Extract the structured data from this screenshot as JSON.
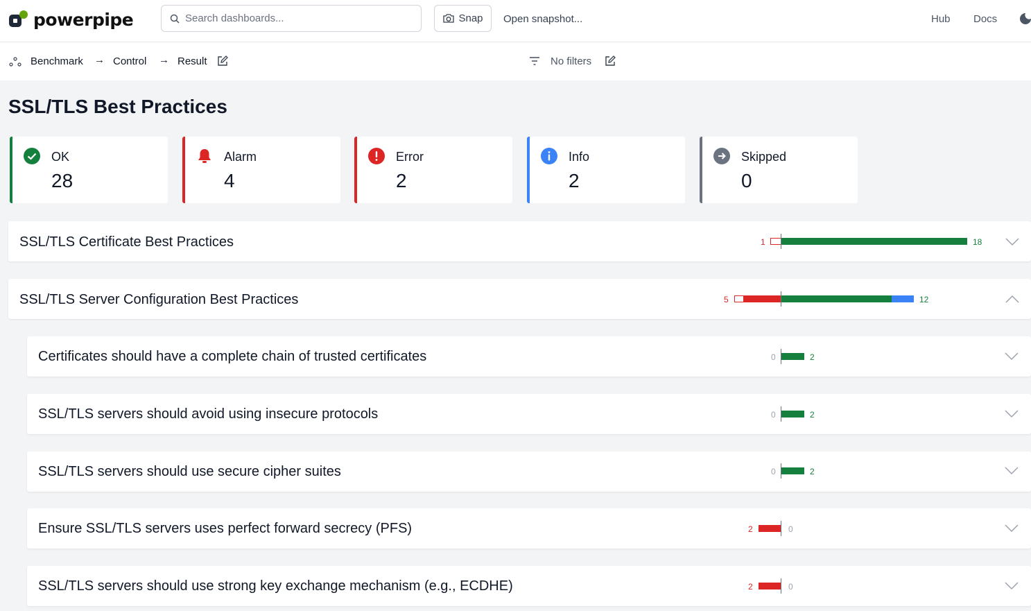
{
  "app": {
    "brand": "powerpipe",
    "search_placeholder": "Search dashboards...",
    "snap_label": "Snap",
    "open_snapshot_label": "Open snapshot...",
    "nav_hub": "Hub",
    "nav_docs": "Docs"
  },
  "breadcrumb": {
    "items": [
      "Benchmark",
      "Control",
      "Result"
    ],
    "arrow": "→",
    "filters_label": "No filters"
  },
  "page": {
    "title": "SSL/TLS Best Practices"
  },
  "summary": [
    {
      "label": "OK",
      "value": "28",
      "color": "#15803d",
      "icon": "check-circle-icon"
    },
    {
      "label": "Alarm",
      "value": "4",
      "color": "#dc2626",
      "icon": "bell-icon"
    },
    {
      "label": "Error",
      "value": "2",
      "color": "#dc2626",
      "icon": "exclamation-circle-icon"
    },
    {
      "label": "Info",
      "value": "2",
      "color": "#3b82f6",
      "icon": "info-circle-icon"
    },
    {
      "label": "Skipped",
      "value": "0",
      "color": "#6b7280",
      "icon": "arrow-right-circle-icon"
    }
  ],
  "groups": [
    {
      "title": "SSL/TLS Certificate Best Practices",
      "left_count": "1",
      "right_count": "18",
      "alarm": 0,
      "error": 1,
      "ok": 17,
      "info": 0,
      "expanded": false
    },
    {
      "title": "SSL/TLS Server Configuration Best Practices",
      "left_count": "5",
      "right_count": "12",
      "alarm": 4,
      "error": 1,
      "ok": 10,
      "info": 2,
      "expanded": true
    }
  ],
  "controls": [
    {
      "title": "Certificates should have a complete chain of trusted certificates",
      "left_count": "0",
      "right_count": "2",
      "alarm": 0,
      "ok": 2
    },
    {
      "title": "SSL/TLS servers should avoid using insecure protocols",
      "left_count": "0",
      "right_count": "2",
      "alarm": 0,
      "ok": 2
    },
    {
      "title": "SSL/TLS servers should use secure cipher suites",
      "left_count": "0",
      "right_count": "2",
      "alarm": 0,
      "ok": 2
    },
    {
      "title": "Ensure SSL/TLS servers uses perfect forward secrecy (PFS)",
      "left_count": "2",
      "right_count": "0",
      "alarm": 2,
      "ok": 0
    },
    {
      "title": "SSL/TLS servers should use strong key exchange mechanism (e.g., ECDHE)",
      "left_count": "2",
      "right_count": "0",
      "alarm": 2,
      "ok": 0
    }
  ]
}
